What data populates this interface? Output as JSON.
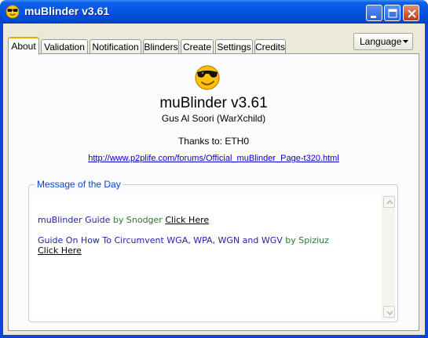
{
  "window": {
    "title": "muBlinder v3.61",
    "icon": "sunglasses-smiley-icon"
  },
  "tabs": [
    {
      "label": "About",
      "active": true
    },
    {
      "label": "Validation",
      "active": false
    },
    {
      "label": "Notification",
      "active": false
    },
    {
      "label": "Blinders",
      "active": false
    },
    {
      "label": "Create",
      "active": false
    },
    {
      "label": "Settings",
      "active": false
    },
    {
      "label": "Credits",
      "active": false
    }
  ],
  "language_dropdown": {
    "label": "Language"
  },
  "about": {
    "logo_icon": "sunglasses-smiley-icon",
    "app_title": "muBlinder v3.61",
    "author": "Gus Al Soori (WarXchild)",
    "thanks": "Thanks to: ETH0",
    "link": "http://www.p2plife.com/forums/Official_muBlinder_Page-t320.html"
  },
  "motd": {
    "title": "Message of the Day",
    "messages": [
      {
        "text": "muBlinder Guide",
        "by": " by ",
        "author": "Snodger",
        "link": "Click Here"
      },
      {
        "text": "Guide On How To Circumvent WGA, WPA, WGN and WGV",
        "by": " by ",
        "author": "Spiziuz",
        "link": "Click Here"
      }
    ]
  },
  "colors": {
    "titlebar": "#0754e2",
    "active_tab_accent": "#f6a200",
    "link": "#0000cc",
    "motd_title": "#0046d5"
  }
}
